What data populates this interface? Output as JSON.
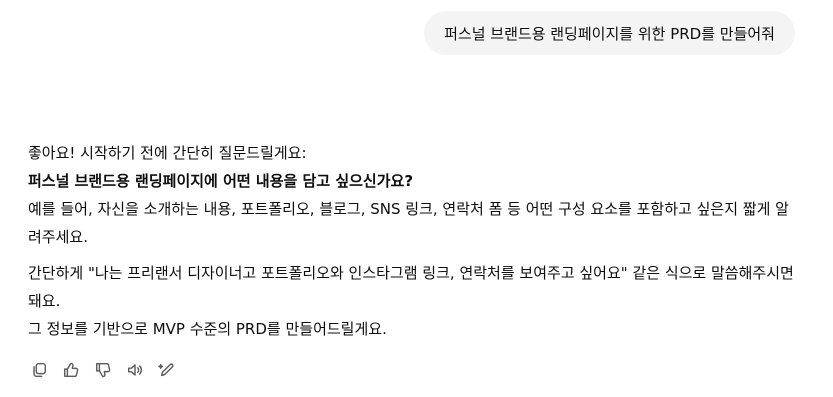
{
  "user_message": {
    "text": "퍼스널 브랜드용 랜딩페이지를 위한 PRD를 만들어줘"
  },
  "assistant_message": {
    "line1": "좋아요! 시작하기 전에 간단히 질문드릴게요:",
    "question": "퍼스널 브랜드용 랜딩페이지에 어떤 내용을 담고 싶으신가요?",
    "detail": "예를 들어, 자신을 소개하는 내용, 포트폴리오, 블로그, SNS 링크, 연락처 폼 등 어떤 구성 요소를 포함하고 싶은지 짧게 알려주세요.",
    "example": "간단하게 \"나는 프리랜서 디자이너고 포트폴리오와 인스타그램 링크, 연락처를 보여주고 싶어요\" 같은 식으로 말씀해주시면 돼요.",
    "closing": "그 정보를 기반으로 MVP 수준의 PRD를 만들어드릴게요."
  },
  "actions": {
    "icons": [
      "copy-icon",
      "thumbs-up-icon",
      "thumbs-down-icon",
      "speaker-icon",
      "edit-icon"
    ]
  }
}
